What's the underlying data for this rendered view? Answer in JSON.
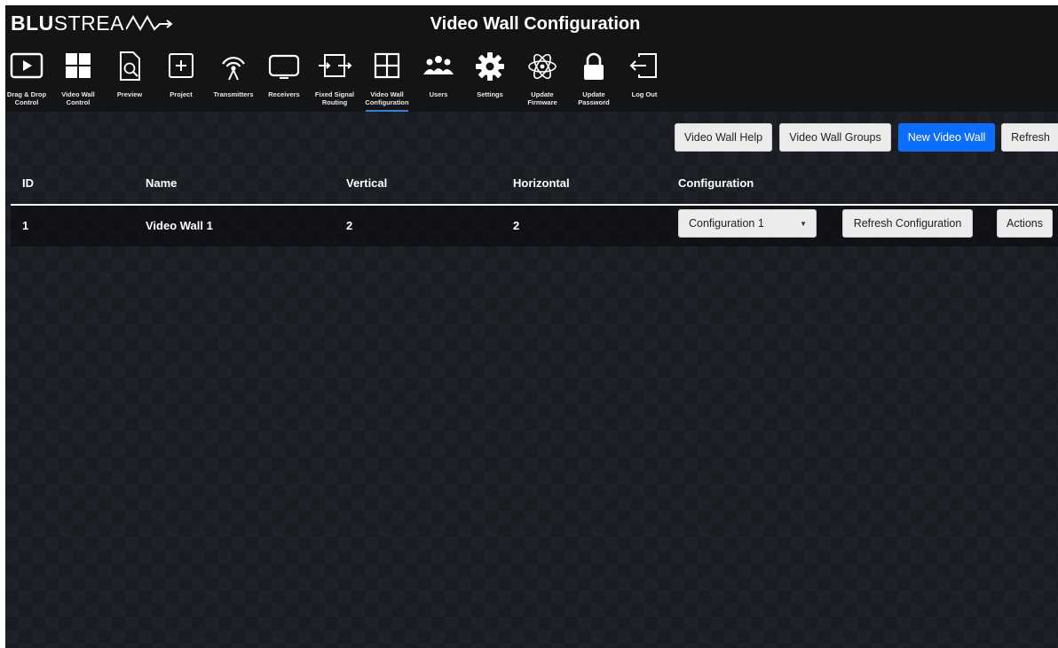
{
  "header": {
    "logo_bold": "BLU",
    "logo_thin": "STREA",
    "title": "Video Wall Configuration"
  },
  "nav": [
    {
      "label": "Drag & Drop\nControl",
      "icon": "play-screen-icon"
    },
    {
      "label": "Video Wall\nControl",
      "icon": "grid-blocks-icon"
    },
    {
      "label": "Preview",
      "icon": "document-search-icon"
    },
    {
      "label": "Project",
      "icon": "plus-box-icon"
    },
    {
      "label": "Transmitters",
      "icon": "antenna-icon"
    },
    {
      "label": "Receivers",
      "icon": "monitor-icon"
    },
    {
      "label": "Fixed Signal\nRouting",
      "icon": "routing-icon"
    },
    {
      "label": "Video Wall\nConfiguration",
      "icon": "grid-icon",
      "active": true
    },
    {
      "label": "Users",
      "icon": "users-icon"
    },
    {
      "label": "Settings",
      "icon": "gear-icon"
    },
    {
      "label": "Update\nFirmware",
      "icon": "atom-icon"
    },
    {
      "label": "Update\nPassword",
      "icon": "lock-icon"
    },
    {
      "label": "Log Out",
      "icon": "logout-icon"
    }
  ],
  "toolbar": {
    "help_label": "Video Wall Help",
    "groups_label": "Video Wall Groups",
    "new_label": "New Video Wall",
    "refresh_label": "Refresh"
  },
  "table": {
    "columns": [
      "ID",
      "Name",
      "Vertical",
      "Horizontal",
      "Configuration"
    ],
    "rows": [
      {
        "id": "1",
        "name": "Video Wall 1",
        "vertical": "2",
        "horizontal": "2",
        "configuration": "Configuration 1",
        "refresh_config_label": "Refresh Configuration",
        "actions_label": "Actions"
      }
    ]
  },
  "colors": {
    "background": "#1a1d22",
    "header": "#131416",
    "primary": "#0d6efd",
    "button": "#ececec"
  }
}
